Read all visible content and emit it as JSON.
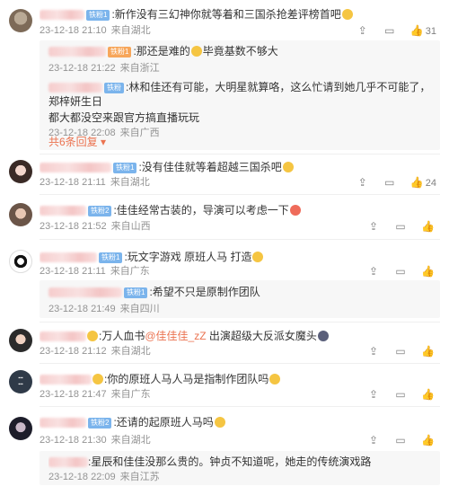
{
  "comments": [
    {
      "badge": "铁粉1",
      "text_before": ":新作没有三幻神你就等着和三国杀抢差评榜首吧",
      "time": "23-12-18 21:10",
      "location": "来自湖北",
      "like_count": "31",
      "replies": [
        {
          "badge": "铁粉1",
          "text": ":那还是难的",
          "text2": "毕竟基数不够大",
          "time": "23-12-18 21:22",
          "location": "来自浙江"
        },
        {
          "badge": "铁粉",
          "text": ":林和佳还有可能，大明星就算咯，这么忙请到她几乎不可能了，郑梓妍生日",
          "text2": "都大都没空来跟官方搞直播玩玩",
          "time": "23-12-18 22:08",
          "location": "来自广西"
        }
      ],
      "more_label": "共6条回复"
    },
    {
      "badge": "铁粉1",
      "text_before": ":没有佳佳就等着超越三国杀吧",
      "time": "23-12-18 21:11",
      "location": "来自湖北",
      "like_count": "24"
    },
    {
      "badge": "铁粉2",
      "text_before": ":佳佳经常古装的，导演可以考虑一下",
      "time": "23-12-18 21:52",
      "location": "来自山西",
      "like_count": ""
    },
    {
      "badge": "铁粉1",
      "text_before": ":玩文字游戏 原班人马 打造",
      "time": "23-12-18 21:11",
      "location": "来自广东",
      "like_count": "",
      "replies": [
        {
          "badge": "铁粉1",
          "text": ":希望不只是原制作团队",
          "text2": "",
          "time": "23-12-18 21:49",
          "location": "来自四川"
        }
      ]
    },
    {
      "badge": "",
      "text_before": ":万人血书",
      "mention": "@佳佳佳_zZ",
      "text_after": " 出演超级大反派女魔头",
      "time": "23-12-18 21:12",
      "location": "来自湖北",
      "like_count": ""
    },
    {
      "badge": "",
      "text_before": ":你的原班人马人马是指制作团队吗",
      "time": "23-12-18 21:47",
      "location": "来自广东",
      "like_count": ""
    },
    {
      "badge": "铁粉2",
      "text_before": ":还请的起原班人马吗",
      "time": "23-12-18 21:30",
      "location": "来自湖北",
      "like_count": "",
      "replies": [
        {
          "badge": "",
          "text": ":星辰和佳佳没那么贵的。钟贞不知道呢，她走的传统演戏路",
          "text2": "",
          "time": "23-12-18 22:09",
          "location": "来自江苏"
        }
      ]
    }
  ],
  "icons": {
    "share": "share-icon",
    "comment": "comment-icon",
    "like": "like-icon"
  },
  "colors": {
    "link": "#eb7350",
    "meta": "#939393",
    "badge": "#7bb4ec"
  }
}
